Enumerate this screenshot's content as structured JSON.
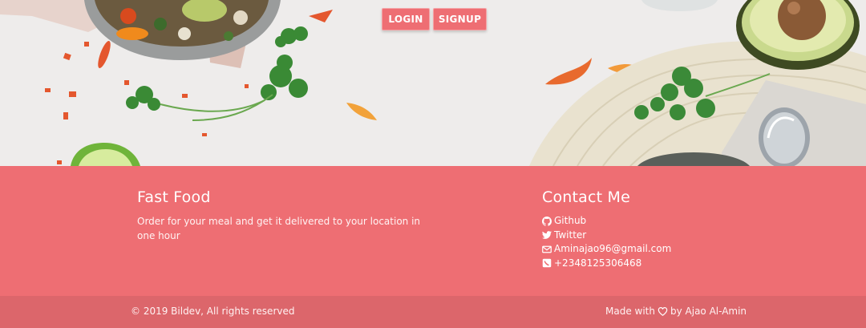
{
  "nav": {
    "login_label": "LOGIN",
    "signup_label": "SIGNUP"
  },
  "about": {
    "title": "Fast Food",
    "text": "Order for your meal and get it delivered to your location in one hour"
  },
  "contact": {
    "title": "Contact Me",
    "github": "Github",
    "twitter": "Twitter",
    "email": "Aminajao96@gmail.com",
    "phone": "+2348125306468"
  },
  "footer": {
    "copyright": "© 2019 Bildev, All rights reserved",
    "made_with": "Made with",
    "by": "by",
    "author": "Ajao Al-Amin"
  },
  "colors": {
    "accent": "#ee6e73",
    "footer_bottom": "#dc666b",
    "hero_bg": "#eeeceb"
  }
}
